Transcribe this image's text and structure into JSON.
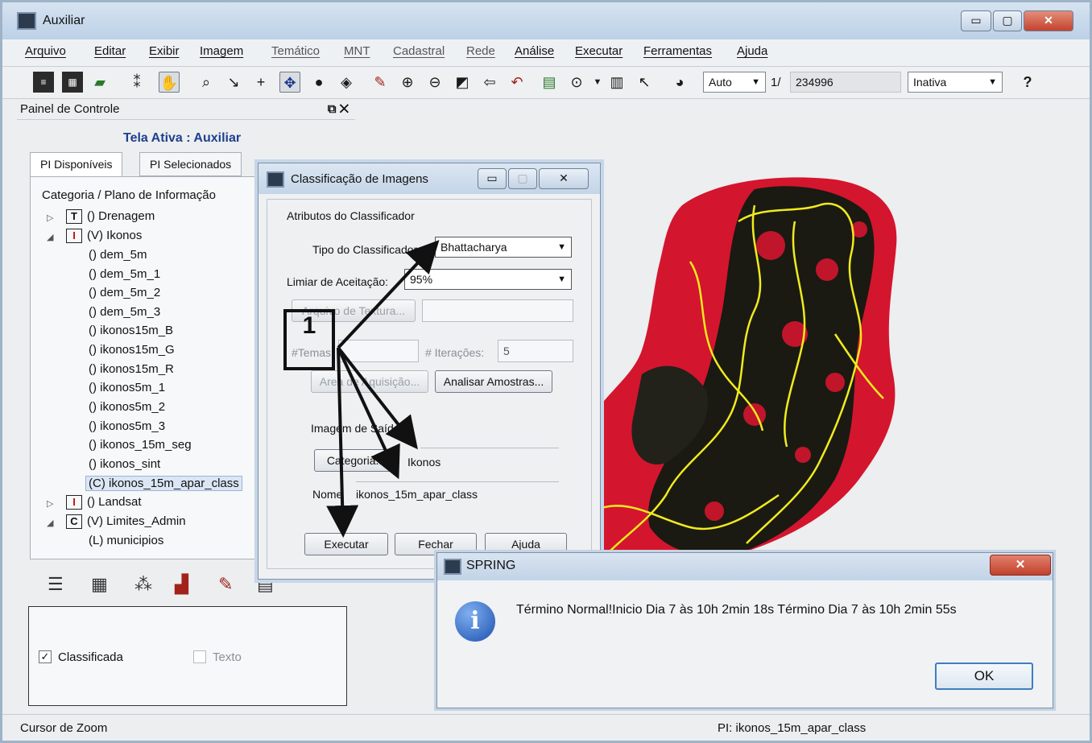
{
  "window": {
    "title": "Auxiliar",
    "buttons": [
      "▭",
      "▢",
      "✕"
    ]
  },
  "menu": [
    "Arquivo",
    "Editar",
    "Exibir",
    "Imagem",
    "Temático",
    "MNT",
    "Cadastral",
    "Rede",
    "Análise",
    "Executar",
    "Ferramentas",
    "Ajuda"
  ],
  "toolbar": {
    "zoom_mode": "Auto",
    "scale_prefix": "1/",
    "scale_value": "234996",
    "state": "Inativa",
    "help": "?"
  },
  "panel": {
    "title": "Painel de Controle",
    "active_screen": "Tela Ativa : Auxiliar",
    "tabs": [
      "PI Disponíveis",
      "PI Selecionados"
    ],
    "tree_header": "Categoria / Plano de Informação",
    "items": [
      {
        "label": "() Drenagem",
        "box": "T"
      },
      {
        "label": "(V) Ikonos",
        "box": "I"
      },
      {
        "label": "() dem_5m"
      },
      {
        "label": "() dem_5m_1"
      },
      {
        "label": "() dem_5m_2"
      },
      {
        "label": "() dem_5m_3"
      },
      {
        "label": "() ikonos15m_B"
      },
      {
        "label": "() ikonos15m_G"
      },
      {
        "label": "() ikonos15m_R"
      },
      {
        "label": "() ikonos5m_1"
      },
      {
        "label": "() ikonos5m_2"
      },
      {
        "label": "() ikonos5m_3"
      },
      {
        "label": "() ikonos_15m_seg"
      },
      {
        "label": "() ikonos_sint"
      },
      {
        "label": "(C) ikonos_15m_apar_class"
      },
      {
        "label": "() Landsat",
        "box": "I"
      },
      {
        "label": "(V) Limites_Admin",
        "box": "C"
      },
      {
        "label": "(L) municipios"
      }
    ],
    "check_classified": "Classificada",
    "check_text": "Texto"
  },
  "dialog": {
    "title": "Classificação de Imagens",
    "group": "Atributos do Classificador",
    "classifier_label": "Tipo do Classificador:",
    "classifier_value": "Bhattacharya",
    "threshold_label": "Limiar de Aceitação:",
    "threshold_value": "95%",
    "texture_button": "Arquivo de Textura...",
    "themes_label": "#Temas:",
    "iterations_label": "# Iterações:",
    "iterations_value": "5",
    "acquisition_button": "Area de Aquisição...",
    "analyze_button": "Analisar Amostras...",
    "output_label": "Imagem de Saída",
    "category_button": "Categoria...",
    "category_value": "Ikonos",
    "name_label": "Nome",
    "name_value": "ikonos_15m_apar_class",
    "execute": "Executar",
    "close": "Fechar",
    "help": "Ajuda"
  },
  "annotation": "1",
  "message": {
    "title": "SPRING",
    "text": "Término Normal!Inicio Dia 7 às 10h 2min 18s Término Dia 7 às 10h 2min 55s",
    "ok": "OK"
  },
  "status": {
    "left": "Cursor de Zoom",
    "right": "PI: ikonos_15m_apar_class"
  },
  "colors": {
    "map_red": "#d4152e",
    "map_dark": "#1a1a12",
    "map_yellow": "#f2ea1e"
  }
}
